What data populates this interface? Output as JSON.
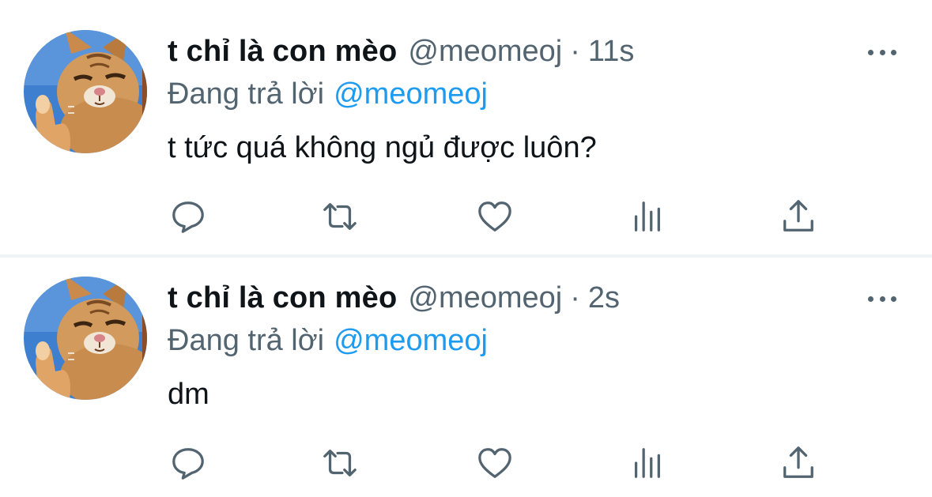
{
  "colors": {
    "text_primary": "#0f1419",
    "text_secondary": "#536471",
    "accent": "#1d9bf0",
    "divider": "#eff3f4"
  },
  "tweets": [
    {
      "display_name": "t chỉ là con mèo",
      "handle": "@meomeoj",
      "separator": "·",
      "time": "11s",
      "reply_prefix": "Đang trả lời",
      "reply_to": "@meomeoj",
      "text": "t tức quá không ngủ được luôn?",
      "avatar_icon": "cat-avatar",
      "actions": [
        "reply-icon",
        "retweet-icon",
        "like-icon",
        "views-icon",
        "share-icon"
      ]
    },
    {
      "display_name": "t chỉ là con mèo",
      "handle": "@meomeoj",
      "separator": "·",
      "time": "2s",
      "reply_prefix": "Đang trả lời",
      "reply_to": "@meomeoj",
      "text": "dm",
      "avatar_icon": "cat-avatar",
      "actions": [
        "reply-icon",
        "retweet-icon",
        "like-icon",
        "views-icon",
        "share-icon"
      ]
    }
  ]
}
